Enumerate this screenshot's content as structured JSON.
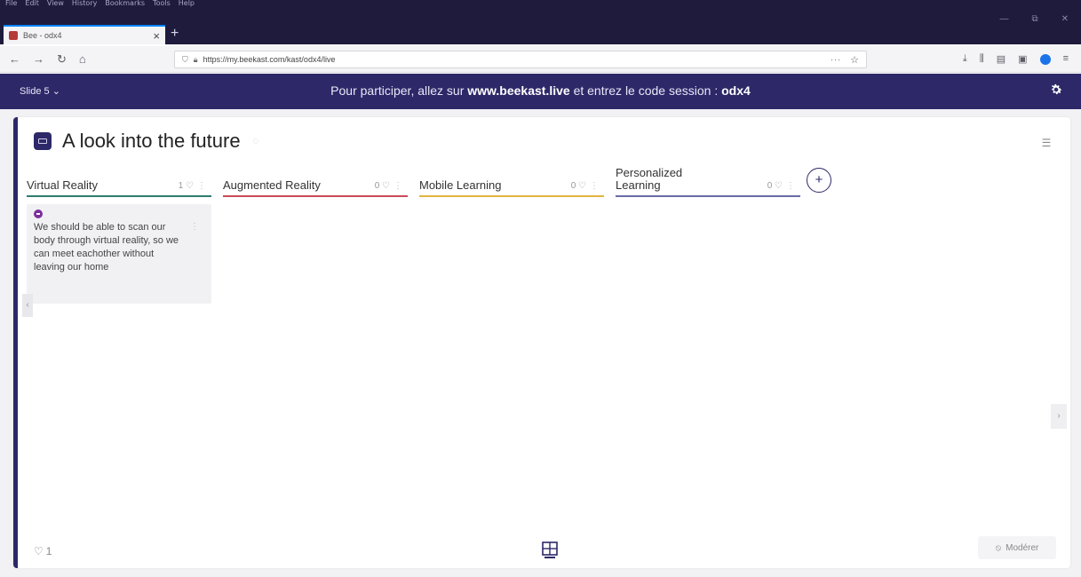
{
  "browser": {
    "menu": [
      "File",
      "Edit",
      "View",
      "History",
      "Bookmarks",
      "Tools",
      "Help"
    ],
    "tab_title": "Bee - odx4",
    "url": "https://my.beekast.com/kast/odx4/live",
    "overflow": "···"
  },
  "header": {
    "slide_label": "Slide 5 ⌄",
    "session_prefix": "Pour participer, allez sur ",
    "session_site": "www.beekast.live",
    "session_middle": " et entrez le code session : ",
    "session_code": "odx4"
  },
  "board": {
    "title": "A look into the future",
    "columns": [
      {
        "name": "Virtual Reality",
        "count": "1",
        "color": "#2e7d6f"
      },
      {
        "name": "Augmented Reality",
        "count": "0",
        "color": "#c94a5a"
      },
      {
        "name": "Mobile Learning",
        "count": "0",
        "color": "#e3b341"
      },
      {
        "name": "Personalized Learning",
        "count": "0",
        "color": "#6b6aa8"
      }
    ],
    "ideas": [
      {
        "column": "Virtual Reality",
        "text": "We should be able to scan our body through virtual reality, so we can meet eachother without leaving our home"
      }
    ],
    "footer_count": "1",
    "moderate_label": "Modérer"
  },
  "colors": {
    "header_bg": "#2d2868",
    "accent": "#2d2868",
    "chrome_bg": "#1f1b3d"
  }
}
